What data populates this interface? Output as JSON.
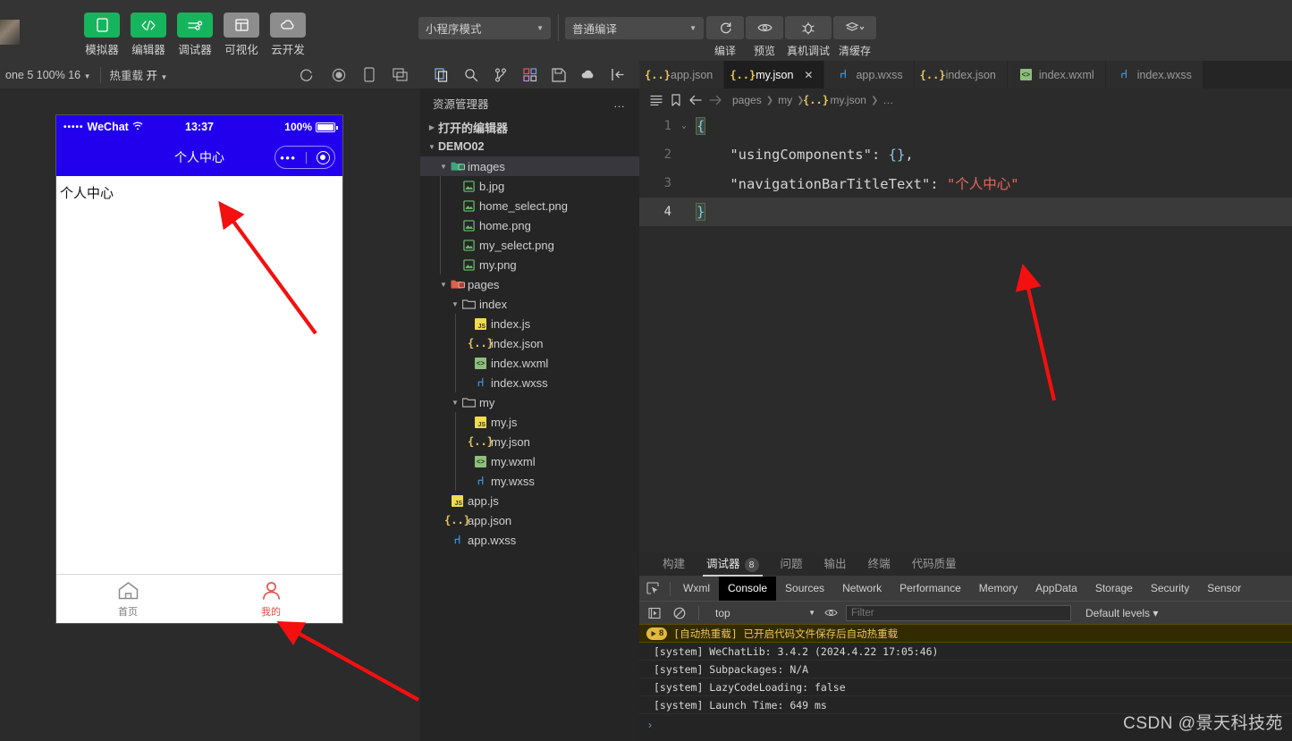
{
  "toolbar": {
    "tools": [
      {
        "label": "模拟器",
        "icon": "phone-icon",
        "style": "green"
      },
      {
        "label": "编辑器",
        "icon": "code-icon",
        "style": "green"
      },
      {
        "label": "调试器",
        "icon": "sliders-icon",
        "style": "green"
      },
      {
        "label": "可视化",
        "icon": "layout-icon",
        "style": "grey"
      },
      {
        "label": "云开发",
        "icon": "cloud-icon",
        "style": "grey"
      }
    ],
    "mode_select": "小程序模式",
    "compile_select": "普通编译",
    "actions": [
      {
        "label": "编译",
        "icon": "refresh-icon"
      },
      {
        "label": "预览",
        "icon": "eye-icon"
      },
      {
        "label": "真机调试",
        "icon": "bug-icon"
      },
      {
        "label": "清缓存",
        "icon": "layers-icon"
      }
    ]
  },
  "sim_toolbar": {
    "device": "one 5 100% 16",
    "hotreload_label": "热重载",
    "hotreload_value": "开",
    "icons": [
      "refresh-circle-icon",
      "record-icon",
      "phone-outline-icon",
      "copy-window-icon"
    ]
  },
  "simulator": {
    "status_bar": {
      "carrier": "WeChat",
      "signal_dots": "•••••",
      "wifi": "⌃",
      "time": "13:37",
      "battery_percent": "100%"
    },
    "nav_title": "个人中心",
    "nav_bg": "#2200ee",
    "page_text": "个人中心",
    "tabbar": [
      {
        "label": "首页",
        "icon": "home-icon",
        "active": false
      },
      {
        "label": "我的",
        "icon": "user-icon",
        "active": true
      }
    ],
    "accent_red": "#e54d42"
  },
  "activity_bar": {
    "icons": [
      "files-icon",
      "search-icon",
      "source-control-icon",
      "extensions-icon",
      "save-all-icon",
      "cloud-upload-icon",
      "collapse-panel-icon"
    ]
  },
  "explorer": {
    "title": "资源管理器",
    "more": "…",
    "sections": [
      {
        "label": "打开的编辑器",
        "expanded": false,
        "depth": 0,
        "kind": "section"
      },
      {
        "label": "DEMO02",
        "expanded": true,
        "depth": 0,
        "kind": "root"
      },
      {
        "label": "images",
        "expanded": true,
        "depth": 1,
        "kind": "folder-img",
        "selected": true
      },
      {
        "label": "b.jpg",
        "depth": 2,
        "kind": "image"
      },
      {
        "label": "home_select.png",
        "depth": 2,
        "kind": "image"
      },
      {
        "label": "home.png",
        "depth": 2,
        "kind": "image"
      },
      {
        "label": "my_select.png",
        "depth": 2,
        "kind": "image"
      },
      {
        "label": "my.png",
        "depth": 2,
        "kind": "image"
      },
      {
        "label": "pages",
        "expanded": true,
        "depth": 1,
        "kind": "folder-pages"
      },
      {
        "label": "index",
        "expanded": true,
        "depth": 2,
        "kind": "folder"
      },
      {
        "label": "index.js",
        "depth": 3,
        "kind": "js"
      },
      {
        "label": "index.json",
        "depth": 3,
        "kind": "json"
      },
      {
        "label": "index.wxml",
        "depth": 3,
        "kind": "wxml"
      },
      {
        "label": "index.wxss",
        "depth": 3,
        "kind": "wxss"
      },
      {
        "label": "my",
        "expanded": true,
        "depth": 2,
        "kind": "folder"
      },
      {
        "label": "my.js",
        "depth": 3,
        "kind": "js"
      },
      {
        "label": "my.json",
        "depth": 3,
        "kind": "json"
      },
      {
        "label": "my.wxml",
        "depth": 3,
        "kind": "wxml"
      },
      {
        "label": "my.wxss",
        "depth": 3,
        "kind": "wxss"
      },
      {
        "label": "app.js",
        "depth": 1,
        "kind": "js"
      },
      {
        "label": "app.json",
        "depth": 1,
        "kind": "json"
      },
      {
        "label": "app.wxss",
        "depth": 1,
        "kind": "wxss"
      }
    ]
  },
  "editor": {
    "tabs": [
      {
        "label": "app.json",
        "kind": "json",
        "active": false,
        "closable": false
      },
      {
        "label": "my.json",
        "kind": "json",
        "active": true,
        "closable": true
      },
      {
        "label": "app.wxss",
        "kind": "wxss",
        "active": false,
        "closable": false
      },
      {
        "label": "index.json",
        "kind": "json",
        "active": false,
        "closable": false
      },
      {
        "label": "index.wxml",
        "kind": "wxml",
        "active": false,
        "closable": false
      },
      {
        "label": "index.wxss",
        "kind": "wxss",
        "active": false,
        "closable": false
      }
    ],
    "breadcrumb": [
      "pages",
      "my",
      "my.json",
      "…"
    ],
    "close_label": "✕",
    "lines": [
      {
        "no": "1",
        "fold": "⌄",
        "current": false,
        "tokens": [
          {
            "t": "{",
            "c": "punc"
          }
        ]
      },
      {
        "no": "2",
        "fold": "",
        "current": false,
        "tokens": [
          {
            "t": "    ",
            "c": "key"
          },
          {
            "t": "\"usingComponents\"",
            "c": "key"
          },
          {
            "t": ": ",
            "c": "key"
          },
          {
            "t": "{}",
            "c": "punc"
          },
          {
            "t": ",",
            "c": "key"
          }
        ]
      },
      {
        "no": "3",
        "fold": "",
        "current": false,
        "tokens": [
          {
            "t": "    ",
            "c": "key"
          },
          {
            "t": "\"navigationBarTitleText\"",
            "c": "key"
          },
          {
            "t": ": ",
            "c": "key"
          },
          {
            "t": "\"个人中心\"",
            "c": "str"
          }
        ]
      },
      {
        "no": "4",
        "fold": "",
        "current": true,
        "tokens": [
          {
            "t": "}",
            "c": "punc"
          }
        ]
      }
    ]
  },
  "devtools": {
    "outer_tabs": [
      {
        "label": "构建",
        "active": false
      },
      {
        "label": "调试器",
        "active": true,
        "badge": "8"
      },
      {
        "label": "问题",
        "active": false
      },
      {
        "label": "输出",
        "active": false
      },
      {
        "label": "终端",
        "active": false
      },
      {
        "label": "代码质量",
        "active": false
      }
    ],
    "inner_tabs": [
      {
        "label": "Wxml",
        "active": false
      },
      {
        "label": "Console",
        "active": true
      },
      {
        "label": "Sources",
        "active": false
      },
      {
        "label": "Network",
        "active": false
      },
      {
        "label": "Performance",
        "active": false
      },
      {
        "label": "Memory",
        "active": false
      },
      {
        "label": "AppData",
        "active": false
      },
      {
        "label": "Storage",
        "active": false
      },
      {
        "label": "Security",
        "active": false
      },
      {
        "label": "Sensor",
        "active": false
      }
    ],
    "context": "top",
    "filter_placeholder": "Filter",
    "filter_value": "",
    "levels": "Default levels ▾",
    "warning": {
      "count": "8",
      "text": "[自动热重载] 已开启代码文件保存后自动热重载"
    },
    "logs": [
      "[system] WeChatLib: 3.4.2 (2024.4.22 17:05:46)",
      "[system] Subpackages: N/A",
      "[system] LazyCodeLoading: false",
      "[system] Launch Time: 649 ms"
    ],
    "prompt": "›"
  },
  "watermark": "CSDN @景天科技苑",
  "annotations": {
    "arrow_color": "#f50f0f",
    "arrows": [
      {
        "name": "arrow-to-page-title"
      },
      {
        "name": "arrow-to-editor-code"
      },
      {
        "name": "arrow-to-tabbar-my"
      }
    ]
  }
}
